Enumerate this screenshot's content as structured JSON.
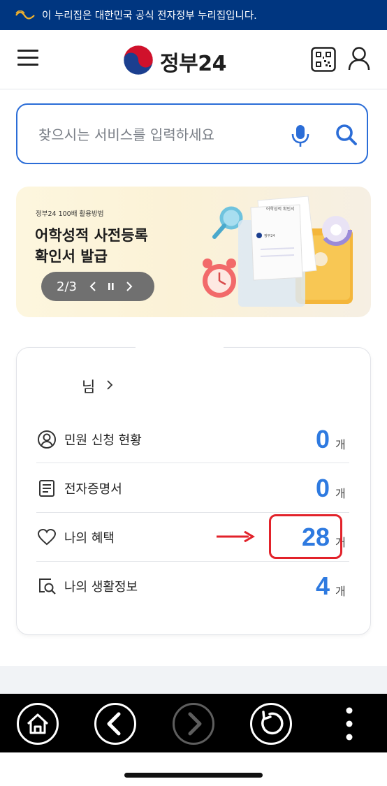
{
  "gov_banner": {
    "text": "이 누리집은 대한민국 공식 전자정부 누리집입니다."
  },
  "header": {
    "logo_text": "정부24"
  },
  "search": {
    "placeholder": "찾으시는 서비스를 입력하세요"
  },
  "promo": {
    "kicker": "정부24 100배 활용방법",
    "title_line1": "어학성적 사전등록",
    "title_line2": "확인서 발급",
    "pager": "2/3",
    "art_doc_title": "어학성적 확인서",
    "art_doc_logo": "정부24"
  },
  "summary": {
    "greeting": "님",
    "rows": [
      {
        "icon": "person-circle-icon",
        "label": "민원 신청 현황",
        "count": "0",
        "unit": "개"
      },
      {
        "icon": "document-icon",
        "label": "전자증명서",
        "count": "0",
        "unit": "개"
      },
      {
        "icon": "heart-icon",
        "label": "나의 혜택",
        "count": "28",
        "unit": "개"
      },
      {
        "icon": "search-document-icon",
        "label": "나의 생활정보",
        "count": "4",
        "unit": "개"
      }
    ]
  },
  "colors": {
    "primary": "#2b6dd7",
    "count": "#2e7ae0",
    "banner": "#003680",
    "highlight": "#e2222a"
  },
  "bottom_nav": [
    "home-icon",
    "back-icon",
    "forward-icon",
    "refresh-icon",
    "more-icon"
  ]
}
